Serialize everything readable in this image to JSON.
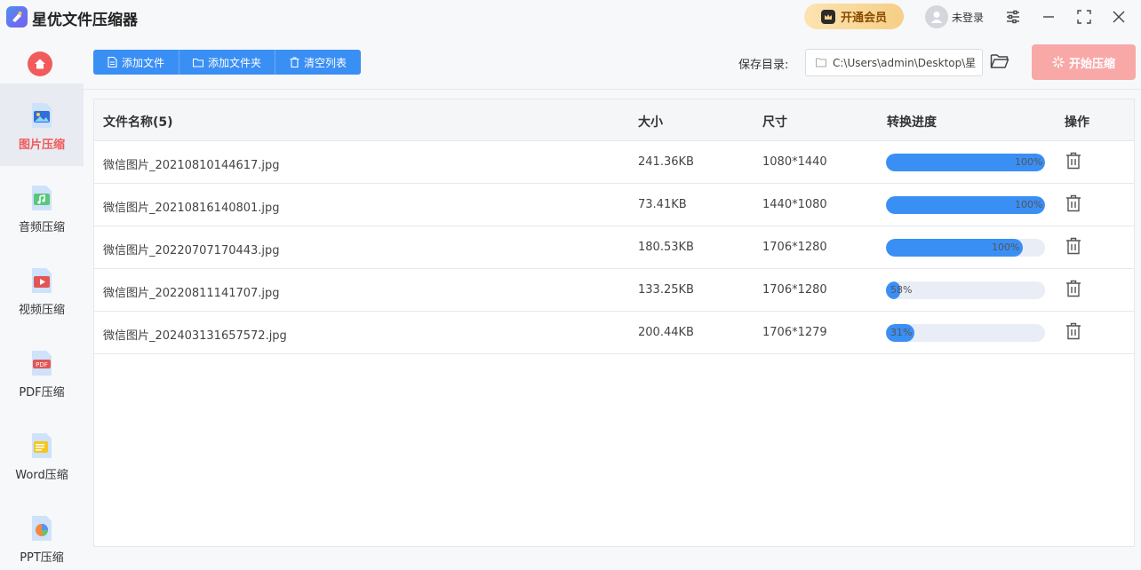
{
  "app": {
    "title": "星优文件压缩器"
  },
  "header": {
    "vip_label": "开通会员",
    "user_label": "未登录"
  },
  "sidebar": {
    "items": [
      {
        "label": "图片压缩",
        "icon": "image-compress-icon",
        "active": true
      },
      {
        "label": "音频压缩",
        "icon": "audio-compress-icon",
        "active": false
      },
      {
        "label": "视频压缩",
        "icon": "video-compress-icon",
        "active": false
      },
      {
        "label": "PDF压缩",
        "icon": "pdf-compress-icon",
        "active": false
      },
      {
        "label": "Word压缩",
        "icon": "word-compress-icon",
        "active": false
      },
      {
        "label": "PPT压缩",
        "icon": "ppt-compress-icon",
        "active": false
      }
    ],
    "pdf_badge": "PDF"
  },
  "toolbar": {
    "add_file": "添加文件",
    "add_folder": "添加文件夹",
    "clear_list": "清空列表",
    "save_label": "保存目录:",
    "save_path": "C:\\Users\\admin\\Desktop\\星",
    "start_label": "开始压缩"
  },
  "table": {
    "columns": [
      "文件名称(5)",
      "大小",
      "尺寸",
      "转换进度",
      "操作"
    ],
    "rows": [
      {
        "name": "微信图片_20210810144617.jpg",
        "size": "241.36KB",
        "dims": "1080*1440",
        "progress": 100,
        "progress_text": "100%"
      },
      {
        "name": "微信图片_20210816140801.jpg",
        "size": "73.41KB",
        "dims": "1440*1080",
        "progress": 100,
        "progress_text": "100%"
      },
      {
        "name": "微信图片_20220707170443.jpg",
        "size": "180.53KB",
        "dims": "1706*1280",
        "progress": 86,
        "progress_text": "100%"
      },
      {
        "name": "微信图片_20220811141707.jpg",
        "size": "133.25KB",
        "dims": "1706*1280",
        "progress": 9,
        "progress_text": "58%"
      },
      {
        "name": "微信图片_202403131657572.jpg",
        "size": "200.44KB",
        "dims": "1706*1279",
        "progress": 18,
        "progress_text": "31%"
      }
    ]
  },
  "colors": {
    "primary": "#3a8ff5",
    "accent_red": "#f05a5a",
    "start_disabled": "#f9a8a8",
    "vip_gold": "#f6cf86"
  }
}
